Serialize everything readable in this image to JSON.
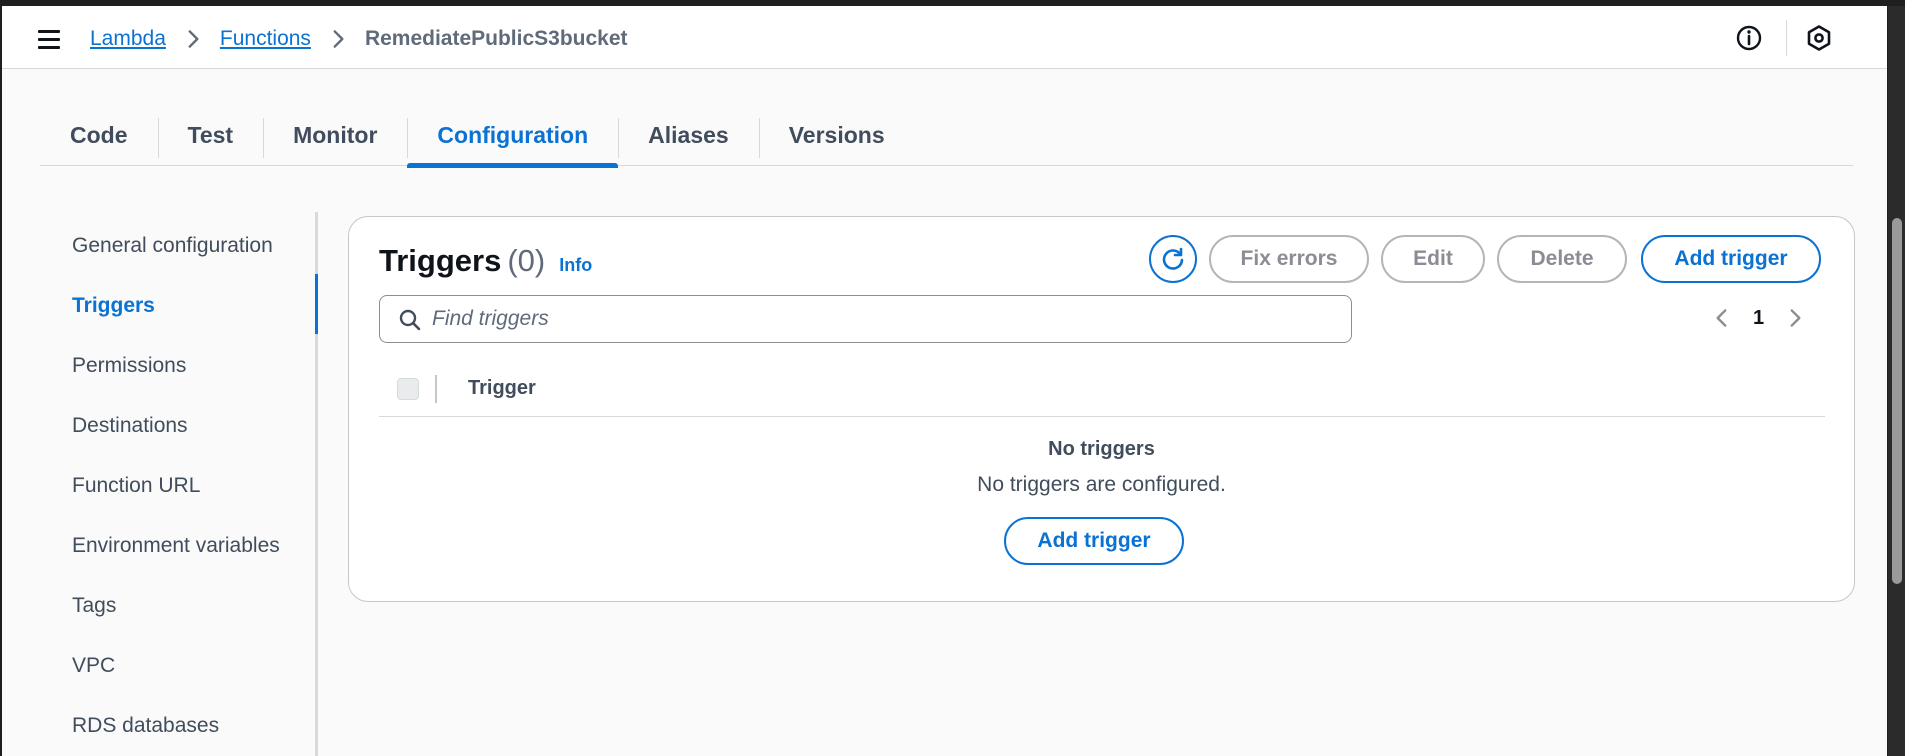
{
  "header": {
    "breadcrumb": [
      {
        "label": "Lambda"
      },
      {
        "label": "Functions"
      }
    ],
    "current": "RemediatePublicS3bucket",
    "icons": [
      "menu-icon",
      "chevron-right-icon",
      "info-icon",
      "hexagon-settings-icon"
    ]
  },
  "tabs": [
    {
      "label": "Code"
    },
    {
      "label": "Test"
    },
    {
      "label": "Monitor"
    },
    {
      "label": "Configuration",
      "active": true
    },
    {
      "label": "Aliases"
    },
    {
      "label": "Versions"
    }
  ],
  "sidenav": {
    "items": [
      {
        "label": "General configuration"
      },
      {
        "label": "Triggers",
        "active": true
      },
      {
        "label": "Permissions"
      },
      {
        "label": "Destinations"
      },
      {
        "label": "Function URL"
      },
      {
        "label": "Environment variables"
      },
      {
        "label": "Tags"
      },
      {
        "label": "VPC"
      },
      {
        "label": "RDS databases"
      }
    ]
  },
  "triggers": {
    "title": "Triggers",
    "count": "(0)",
    "info": "Info",
    "buttons": {
      "fix_errors": "Fix errors",
      "edit": "Edit",
      "delete": "Delete",
      "add_trigger": "Add trigger"
    },
    "search": {
      "placeholder": "Find triggers",
      "value": ""
    },
    "pagination": {
      "page": "1"
    },
    "table": {
      "columns": [
        "Trigger"
      ],
      "rows": []
    },
    "empty": {
      "title": "No triggers",
      "description": "No triggers are configured.",
      "button": "Add trigger"
    }
  },
  "colors": {
    "accent": "#0972d3",
    "text": "#0f141a",
    "muted": "#414d5c",
    "disabled": "#8c8c94",
    "background": "#fafafa"
  }
}
